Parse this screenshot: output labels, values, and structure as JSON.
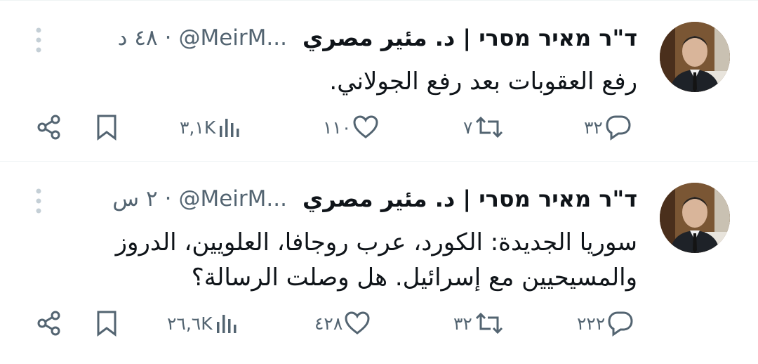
{
  "tweets": [
    {
      "display_name": "ד\"ר מאיר מסרי | د. مئير مصري",
      "handle": "@MeirM...",
      "separator": "·",
      "time": "٤٨ د",
      "text": "رفع العقوبات بعد رفع الجولاني.",
      "stats": {
        "replies": "٣٢",
        "reposts": "٧",
        "likes": "١١٠",
        "views": "٣,١K"
      }
    },
    {
      "display_name": "ד\"ר מאיר מסרי | د. مئير مصري",
      "handle": "@MeirM...",
      "separator": "·",
      "time": "٢ س",
      "text": "سوريا الجديدة: الكورد، عرب روجافا، العلويين، الدروز\nوالمسيحيين مع إسرائيل. هل وصلت الرسالة؟",
      "stats": {
        "replies": "٢٢٢",
        "reposts": "٣٢",
        "likes": "٤٢٨",
        "views": "٢٦,٦K"
      }
    }
  ],
  "icons": [
    "more-icon",
    "reply-icon",
    "repost-icon",
    "like-icon",
    "views-icon",
    "bookmark-icon",
    "share-icon"
  ],
  "colors": {
    "text": "#0f1419",
    "secondary": "#536471",
    "divider": "#eff3f4"
  }
}
